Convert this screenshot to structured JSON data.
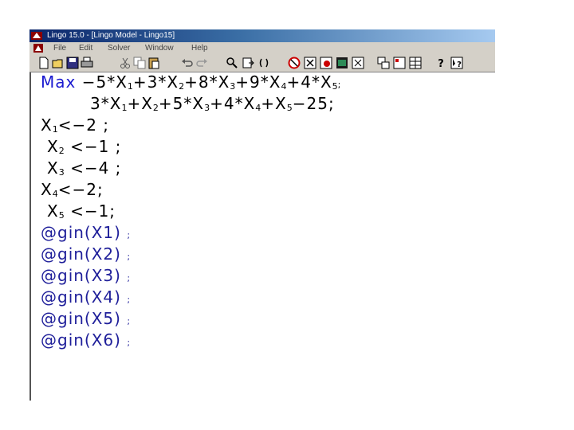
{
  "window": {
    "title": "Lingo 15.0 - [Lingo Model - Lingo15]"
  },
  "menu": {
    "items": [
      "File",
      "Edit",
      "Solver",
      "Window",
      "Help"
    ]
  },
  "toolbar": {
    "icons": [
      "new-icon",
      "open-icon",
      "save-icon",
      "print-icon",
      "cut-icon",
      "copy-icon",
      "paste-icon",
      "undo-icon",
      "redo-icon",
      "find-icon",
      "goto-icon",
      "match-paren-icon",
      "solve-icon",
      "close-solution-icon",
      "send-to-back-icon",
      "close-all-icon",
      "tile-icon",
      "cascade-icon",
      "help-icon",
      "context-help-icon"
    ]
  },
  "code": {
    "objective": {
      "keyword": "Max",
      "sign1": "−",
      "t1": "5*X",
      "s1": "1",
      "t2": "+3*X",
      "s2": "2",
      "t3": "+8*X",
      "s3": "3",
      "t4": "+9*X",
      "s4": "4",
      "t5": "+4*X",
      "s5": "5",
      "semi": ";"
    },
    "constraint": {
      "t1": "3*X",
      "s1": "1",
      "t2": "+X",
      "s2": "2",
      "t3": "+5*X",
      "s3": "3",
      "t4": "+4*X",
      "s4": "4",
      "t5": "+X",
      "s5": "5",
      "tail": "−25;"
    },
    "bounds": [
      {
        "var": "X",
        "sub": "1",
        "rest": "<−2 ;"
      },
      {
        "var": "X",
        "sub": "2",
        "rest": "<−1 ;"
      },
      {
        "var": "X",
        "sub": "3",
        "rest": "<−4 ;"
      },
      {
        "var": "X",
        "sub": "4",
        "rest": "<−2;"
      },
      {
        "var": "X",
        "sub": "5",
        "rest": "<−1;"
      }
    ],
    "gin": [
      {
        "text": "@gin(X1)",
        "semi": ";"
      },
      {
        "text": "@gin(X2)",
        "semi": ";"
      },
      {
        "text": "@gin(X3)",
        "semi": ";"
      },
      {
        "text": "@gin(X4)",
        "semi": ";"
      },
      {
        "text": "@gin(X5)",
        "semi": ";"
      },
      {
        "text": "@gin(X6)",
        "semi": ";"
      }
    ]
  },
  "colors": {
    "keyword": "#1a1ad0",
    "title_bar": "#0a246a",
    "chrome": "#d4d0c8"
  }
}
